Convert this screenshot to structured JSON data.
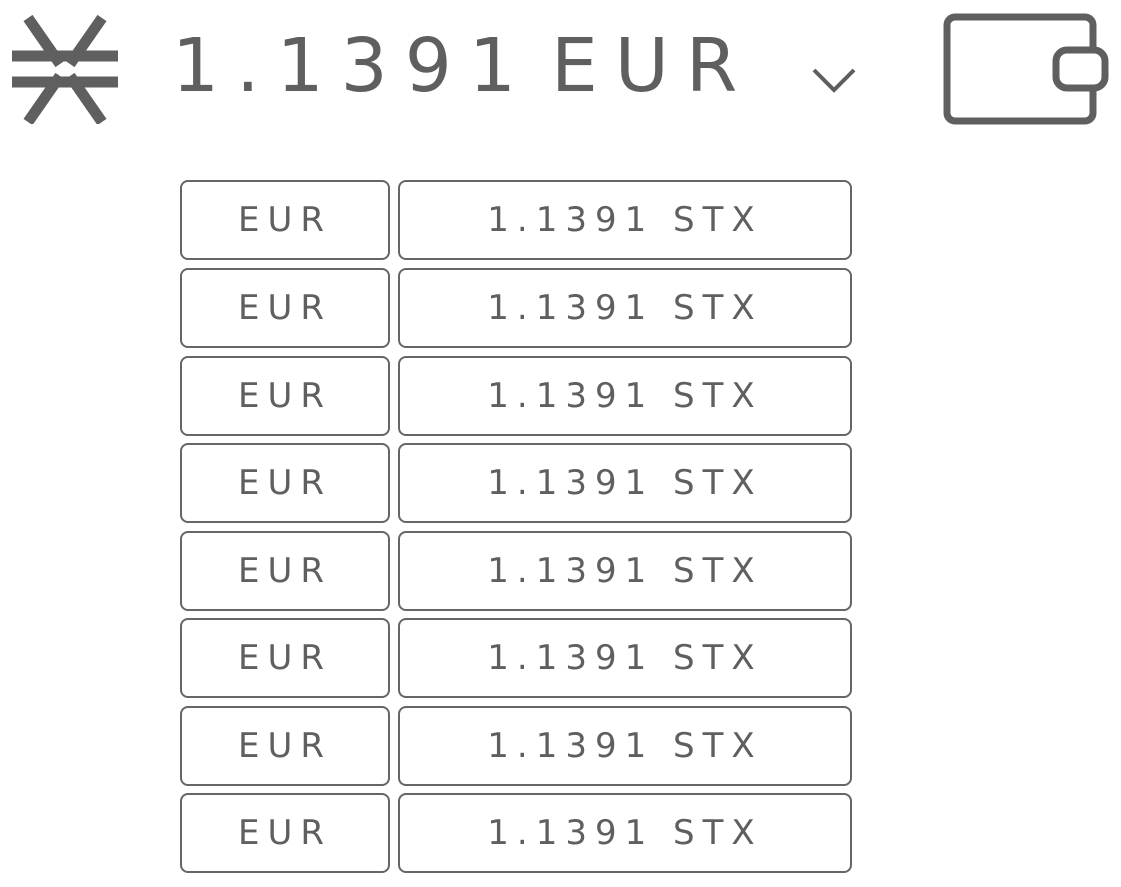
{
  "header": {
    "price_value": "1.1391",
    "price_currency": "EUR",
    "logo_icon": "stacks-logo-icon",
    "toggle_icon": "chevron-down-icon",
    "wallet_icon": "wallet-icon"
  },
  "rates": [
    {
      "currency": "EUR",
      "amount": "1.1391 STX"
    },
    {
      "currency": "EUR",
      "amount": "1.1391 STX"
    },
    {
      "currency": "EUR",
      "amount": "1.1391 STX"
    },
    {
      "currency": "EUR",
      "amount": "1.1391 STX"
    },
    {
      "currency": "EUR",
      "amount": "1.1391 STX"
    },
    {
      "currency": "EUR",
      "amount": "1.1391 STX"
    },
    {
      "currency": "EUR",
      "amount": "1.1391 STX"
    },
    {
      "currency": "EUR",
      "amount": "1.1391 STX"
    }
  ],
  "colors": {
    "foreground": "#5f5f5f",
    "border": "#666666",
    "background": "#ffffff"
  }
}
